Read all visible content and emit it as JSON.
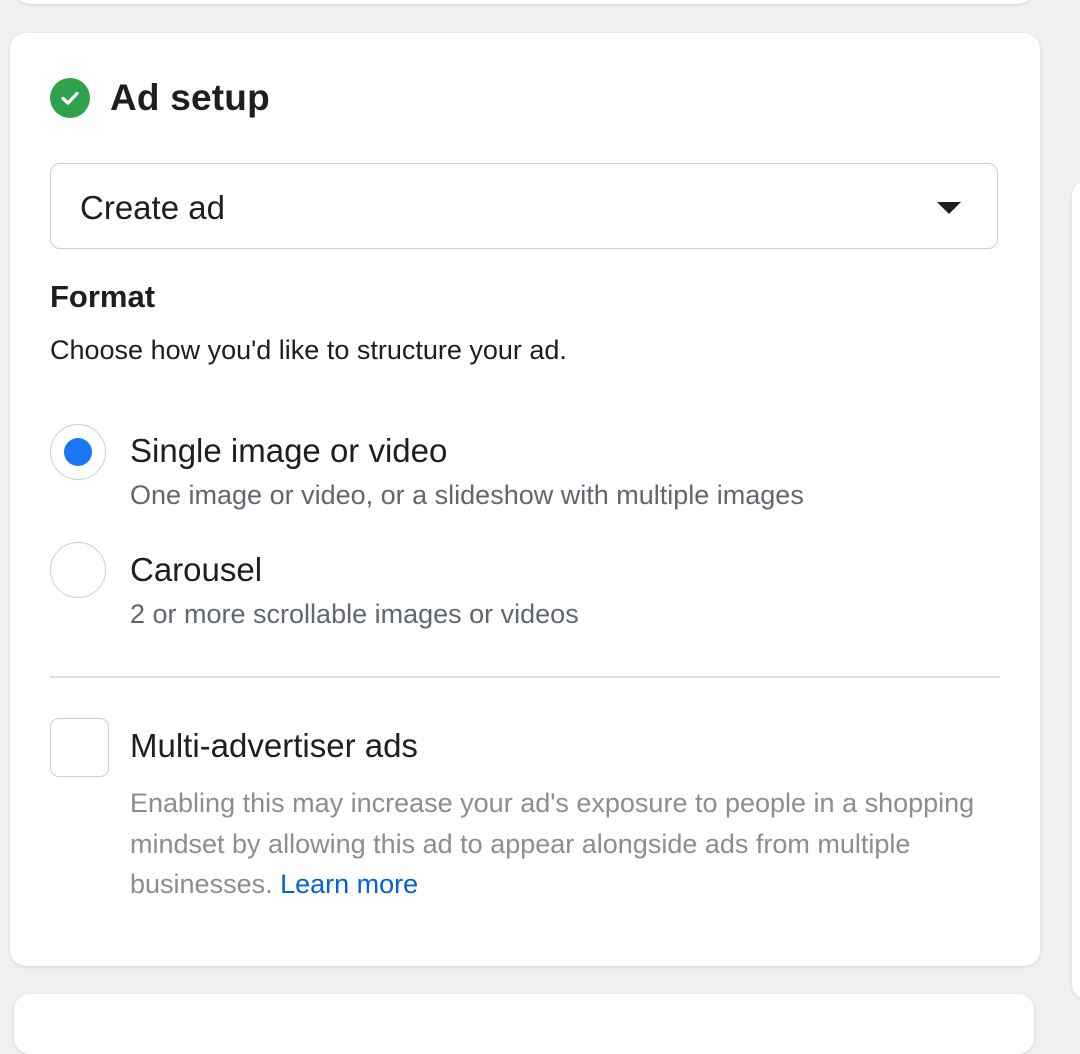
{
  "section": {
    "title": "Ad setup",
    "status_icon": "check-circle-icon",
    "status_color": "#31a24c"
  },
  "ad_select": {
    "value": "Create ad",
    "icon": "caret-down-icon"
  },
  "format": {
    "title": "Format",
    "description": "Choose how you'd like to structure your ad.",
    "options": [
      {
        "label": "Single image or video",
        "description": "One image or video, or a slideshow with multiple images",
        "selected": true
      },
      {
        "label": "Carousel",
        "description": "2 or more scrollable images or videos",
        "selected": false
      }
    ]
  },
  "multi_advertiser": {
    "label": "Multi-advertiser ads",
    "checked": false,
    "description": "Enabling this may increase your ad's exposure to people in a shopping mindset by allowing this ad to appear alongside ads from multiple businesses.",
    "link_text": "Learn more"
  },
  "colors": {
    "accent": "#1877f2",
    "link": "#0064d1",
    "success": "#31a24c"
  }
}
